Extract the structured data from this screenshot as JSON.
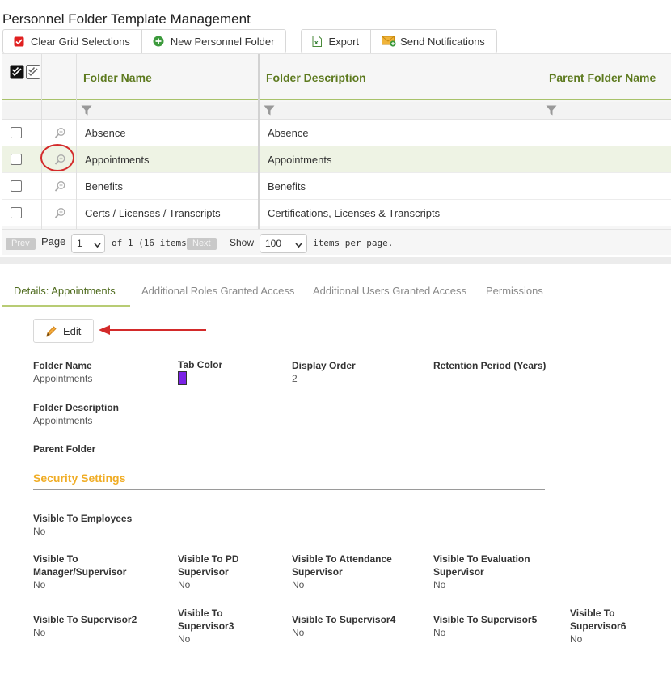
{
  "page": {
    "title": "Personnel Folder Template Management"
  },
  "toolbar": {
    "clear_label": "Clear Grid Selections",
    "new_label": "New Personnel Folder",
    "export_label": "Export",
    "notify_label": "Send Notifications"
  },
  "grid": {
    "columns": {
      "name": "Folder Name",
      "description": "Folder Description",
      "parent": "Parent Folder Name"
    },
    "rows": [
      {
        "name": "Absence",
        "description": "Absence"
      },
      {
        "name": "Appointments",
        "description": "Appointments"
      },
      {
        "name": "Benefits",
        "description": "Benefits"
      },
      {
        "name": "Certs / Licenses / Transcripts",
        "description": "Certifications, Licenses & Transcripts"
      }
    ]
  },
  "pager": {
    "prev": "Prev",
    "page_label": "Page",
    "page_value": "1",
    "of_text": "of 1 (16 items)",
    "next": "Next",
    "show_label": "Show",
    "per_page_value": "100",
    "per_page_suffix": "items per page."
  },
  "tabs": [
    {
      "label": "Details: Appointments"
    },
    {
      "label": "Additional Roles Granted Access"
    },
    {
      "label": "Additional Users Granted Access"
    },
    {
      "label": "Permissions"
    }
  ],
  "details": {
    "edit_label": "Edit",
    "folder_name_label": "Folder Name",
    "folder_name_value": "Appointments",
    "tab_color_label": "Tab Color",
    "tab_color": "#7b22e6",
    "display_order_label": "Display Order",
    "display_order_value": "2",
    "retention_label": "Retention Period (Years)",
    "folder_desc_label": "Folder Description",
    "folder_desc_value": "Appointments",
    "parent_folder_label": "Parent Folder",
    "security_title": "Security Settings",
    "visibility": {
      "employees": {
        "label": "Visible To Employees",
        "value": "No"
      },
      "manager": {
        "label": "Visible To Manager/Supervisor",
        "value": "No"
      },
      "pd": {
        "label": "Visible To PD Supervisor",
        "value": "No"
      },
      "attendance": {
        "label": "Visible To Attendance Supervisor",
        "value": "No"
      },
      "evaluation": {
        "label": "Visible To Evaluation Supervisor",
        "value": "No"
      },
      "sup2": {
        "label": "Visible To Supervisor2",
        "value": "No"
      },
      "sup3": {
        "label": "Visible To Supervisor3",
        "value": "No"
      },
      "sup4": {
        "label": "Visible To Supervisor4",
        "value": "No"
      },
      "sup5": {
        "label": "Visible To Supervisor5",
        "value": "No"
      },
      "sup6": {
        "label": "Visible To Supervisor6",
        "value": "No"
      }
    }
  },
  "icons": [
    "checkbox-red-icon",
    "plus-circle-icon",
    "excel-icon",
    "envelope-icon",
    "filter-icon",
    "zoom-icon",
    "pencil-icon"
  ]
}
